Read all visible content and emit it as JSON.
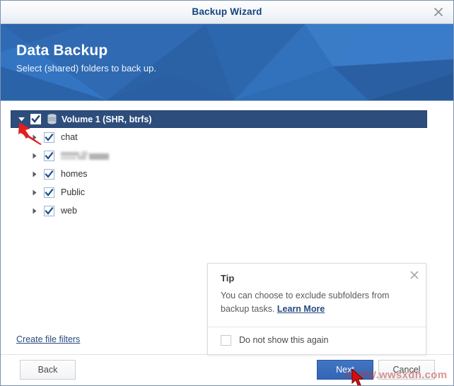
{
  "window": {
    "titlebar": {
      "title": "Backup Wizard",
      "close_icon": "close-icon"
    }
  },
  "banner": {
    "title": "Data Backup",
    "subtitle": "Select (shared) folders to back up.",
    "bg_color": "#2a66ad"
  },
  "tree": {
    "volume": {
      "label": "Volume 1 (SHR, btrfs)",
      "checked": true,
      "expanded": true,
      "icon": "disk-volume-icon",
      "selected_bg": "#2d4d7c"
    },
    "folders": [
      {
        "label": "chat",
        "checked": true,
        "expanded": false,
        "redacted": false
      },
      {
        "label": "",
        "checked": true,
        "expanded": false,
        "redacted": true
      },
      {
        "label": "homes",
        "checked": true,
        "expanded": false,
        "redacted": false
      },
      {
        "label": "Public",
        "checked": true,
        "expanded": false,
        "redacted": false
      },
      {
        "label": "web",
        "checked": true,
        "expanded": false,
        "redacted": false
      }
    ]
  },
  "tip": {
    "title": "Tip",
    "text": "You can choose to exclude subfolders from backup tasks. ",
    "learn_more": "Learn More",
    "close_icon": "close-icon",
    "do_not_show_label": "Do not show this again",
    "do_not_show_checked": false
  },
  "links": {
    "create_file_filters": "Create file filters"
  },
  "footer": {
    "back_label": "Back",
    "next_label": "Next",
    "cancel_label": "Cancel",
    "primary_color": "#3265b3"
  },
  "overlay": {
    "watermark": "WWW.wwsxdn.com",
    "annotation_arrow_color": "#e02020"
  }
}
